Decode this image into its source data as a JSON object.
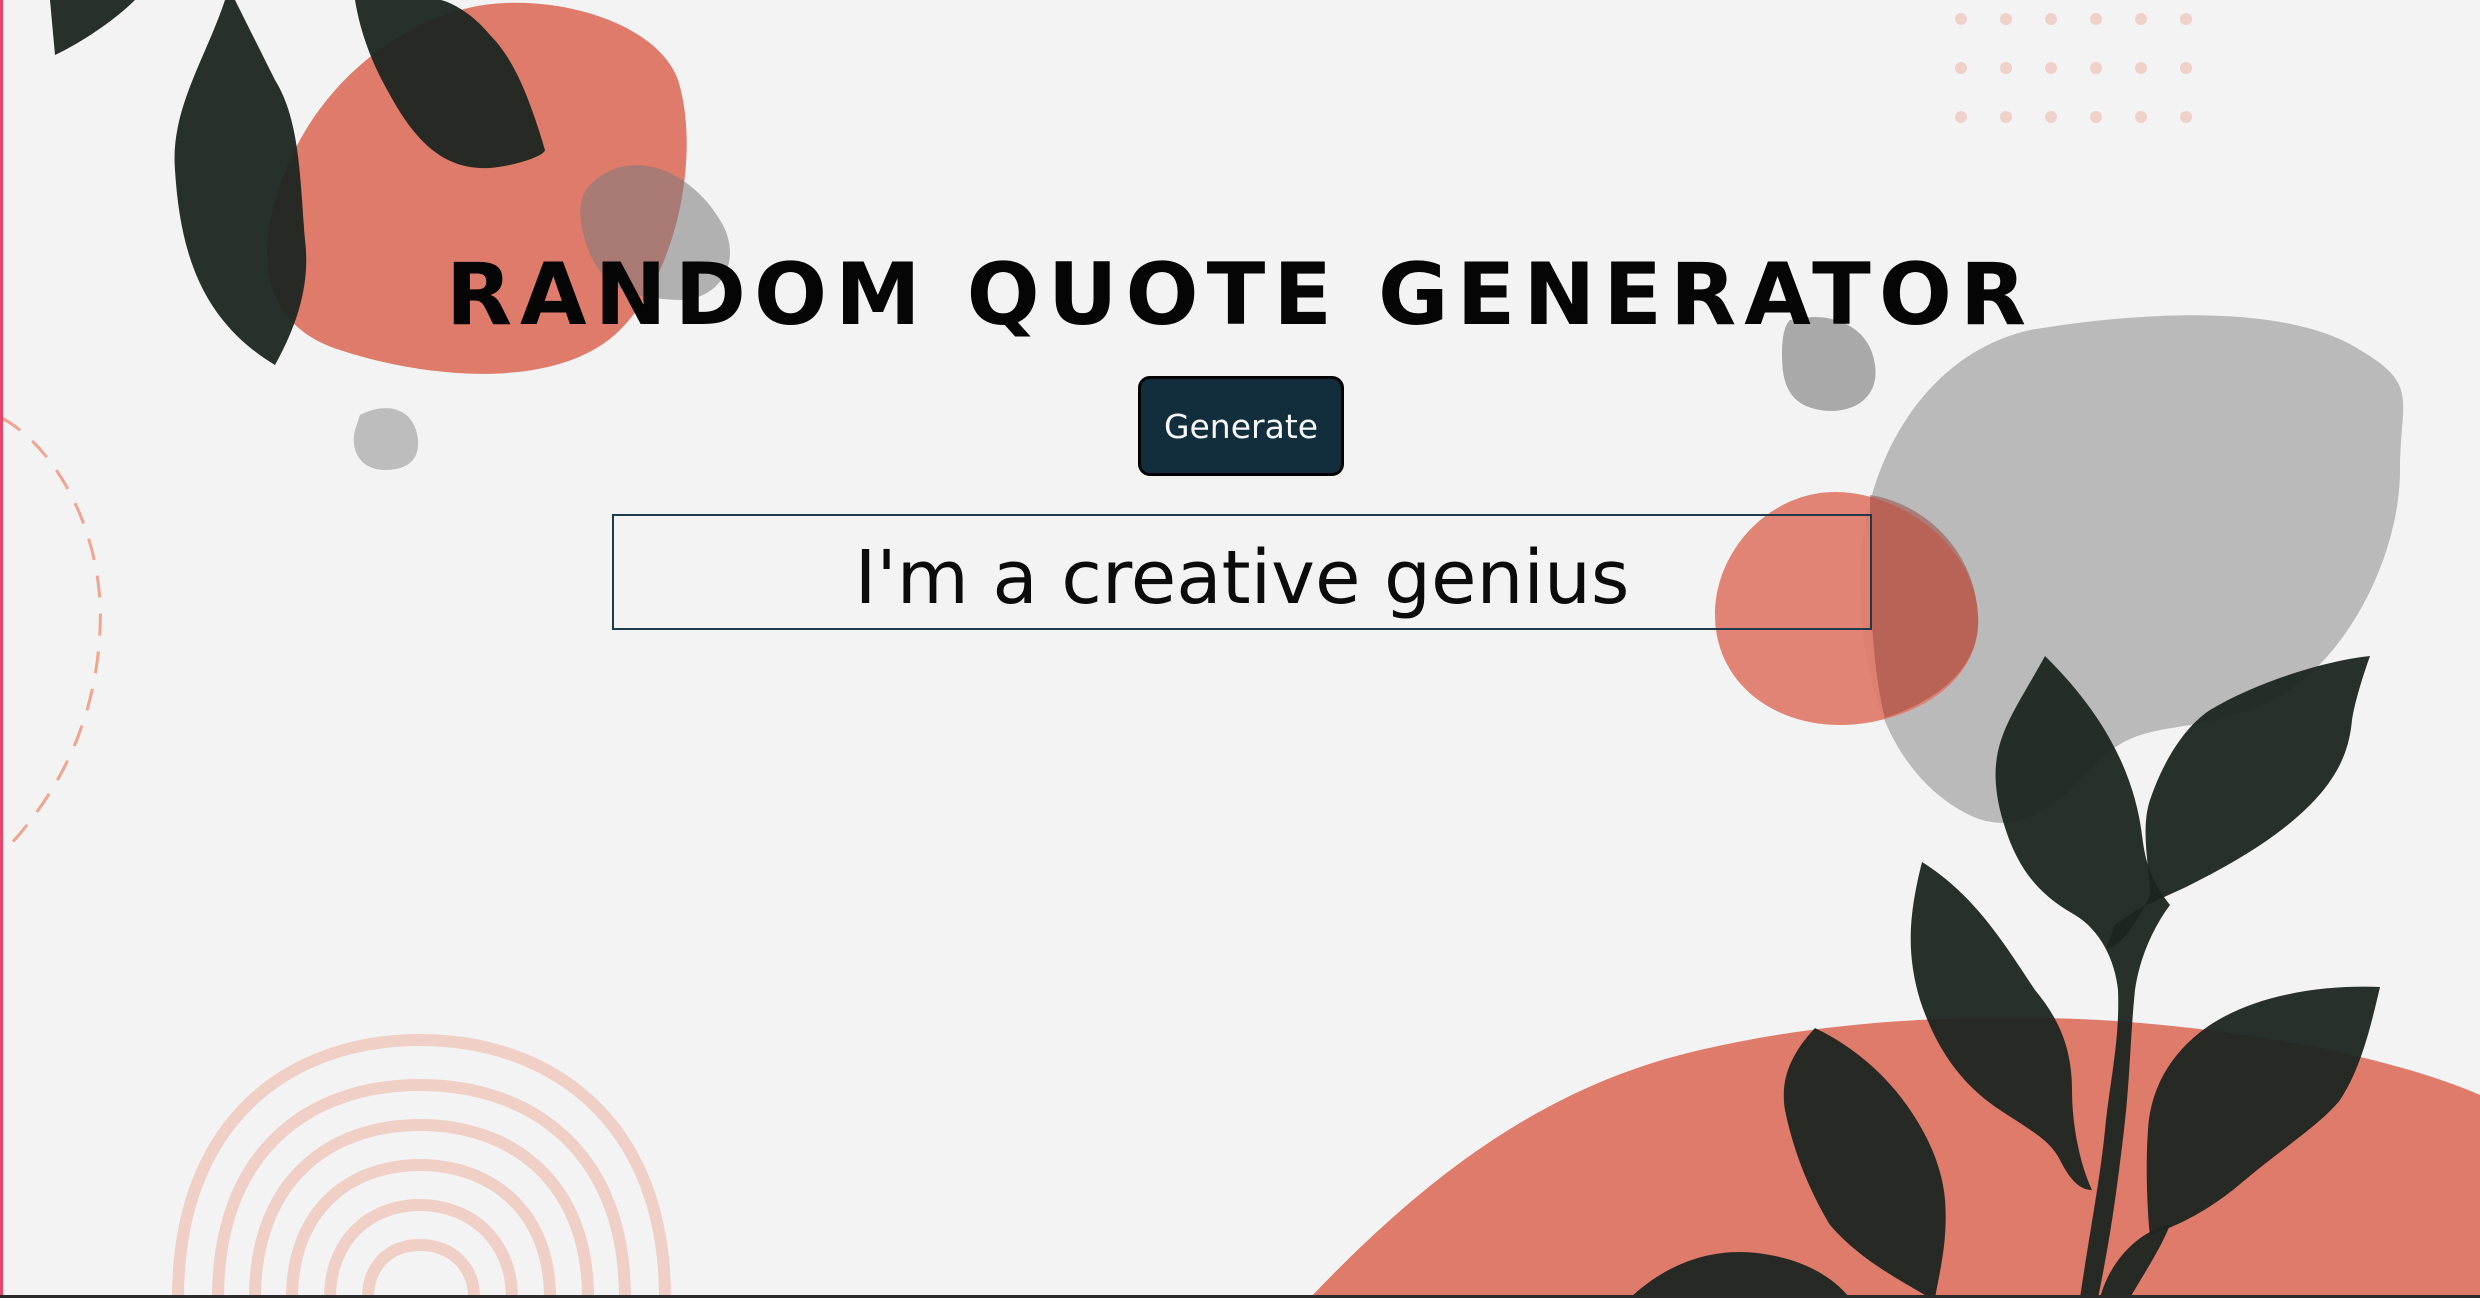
{
  "app": {
    "title": "Random Quote Generator"
  },
  "controls": {
    "generate_label": "Generate"
  },
  "quote": {
    "text": "I'm a creative genius"
  },
  "colors": {
    "background": "#f3f3f3",
    "accent_coral": "#df7b6a",
    "leaf_dark": "#1c2521",
    "blob_gray": "#bdbdbd",
    "button_bg": "#122e3d",
    "button_text": "#f6f6f6",
    "dots_pink": "#efd1c9"
  }
}
